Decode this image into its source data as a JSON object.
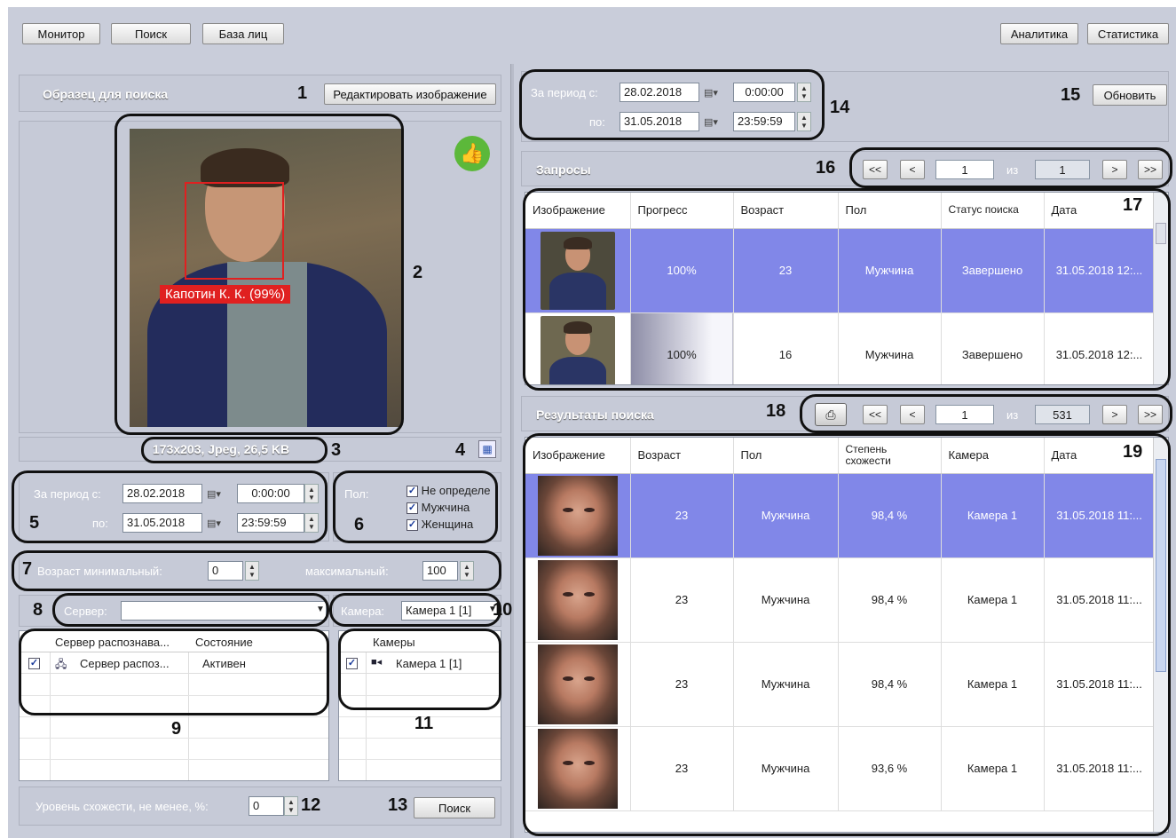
{
  "toolbar": {
    "monitor": "Монитор",
    "search": "Поиск",
    "facebase": "База лиц",
    "analytics": "Аналитика",
    "statistics": "Статистика"
  },
  "sample": {
    "title": "Образец для поиска",
    "edit_button": "Редактировать изображение",
    "face_label": "Капотин К. К. (99%)",
    "image_info": "173x203, Jpeg, 26,5 KB"
  },
  "filters": {
    "period_from_label": "За период с:",
    "period_to_label": "по:",
    "date_from": "28.02.2018",
    "time_from": "0:00:00",
    "date_to": "31.05.2018",
    "time_to": "23:59:59",
    "gender_label": "Пол:",
    "gender_options": [
      "Не определе",
      "Мужчина",
      "Женщина"
    ],
    "age_min_label": "Возраст минимальный:",
    "age_min": "0",
    "age_max_label": "максимальный:",
    "age_max": "100",
    "server_label": "Сервер:",
    "server_value": "",
    "camera_label": "Камера:",
    "camera_value": "Камера 1 [1]",
    "similarity_label": "Уровень схожести, не менее, %:",
    "similarity_value": "0",
    "search_button": "Поиск"
  },
  "servers_table": {
    "headers": [
      "Сервер распознава...",
      "Состояние"
    ],
    "rows": [
      {
        "name": "Сервер распоз...",
        "status": "Активен"
      }
    ]
  },
  "cameras_table": {
    "header": "Камеры",
    "rows": [
      {
        "name": "Камера 1 [1]"
      }
    ]
  },
  "right": {
    "period_from_label": "За период с:",
    "period_to_label": "по:",
    "date_from": "28.02.2018",
    "time_from": "0:00:00",
    "date_to": "31.05.2018",
    "time_to": "23:59:59",
    "refresh_button": "Обновить",
    "requests_title": "Запросы",
    "requests_pager": {
      "first": "<<",
      "prev": "<",
      "page": "1",
      "of": "из",
      "total": "1",
      "next": ">",
      "last": ">>"
    },
    "requests_headers": [
      "Изображение",
      "Прогресс",
      "Возраст",
      "Пол",
      "Статус поиска",
      "Дата"
    ],
    "requests": [
      {
        "progress": "100%",
        "progress_fraction": 1.0,
        "age": "23",
        "gender": "Мужчина",
        "status": "Завершено",
        "date": "31.05.2018 12:..."
      },
      {
        "progress": "100%",
        "progress_fraction": 1.0,
        "age": "16",
        "gender": "Мужчина",
        "status": "Завершено",
        "date": "31.05.2018 12:..."
      }
    ],
    "results_title": "Результаты поиска",
    "results_pager": {
      "first": "<<",
      "prev": "<",
      "page": "1",
      "of": "из",
      "total": "531",
      "next": ">",
      "last": ">>"
    },
    "results_headers": [
      "Изображение",
      "Возраст",
      "Пол",
      "Степень схожести",
      "Камера",
      "Дата"
    ],
    "results": [
      {
        "age": "23",
        "gender": "Мужчина",
        "similarity": "98,4 %",
        "camera": "Камера 1",
        "date": "31.05.2018 11:..."
      },
      {
        "age": "23",
        "gender": "Мужчина",
        "similarity": "98,4 %",
        "camera": "Камера 1",
        "date": "31.05.2018 11:..."
      },
      {
        "age": "23",
        "gender": "Мужчина",
        "similarity": "98,4 %",
        "camera": "Камера 1",
        "date": "31.05.2018 11:..."
      },
      {
        "age": "23",
        "gender": "Мужчина",
        "similarity": "93,6 %",
        "camera": "Камера 1",
        "date": "31.05.2018 11:..."
      }
    ]
  },
  "callouts": [
    "1",
    "2",
    "3",
    "4",
    "5",
    "6",
    "7",
    "8",
    "9",
    "10",
    "11",
    "12",
    "13",
    "14",
    "15",
    "16",
    "17",
    "18",
    "19"
  ],
  "colors": {
    "background": "#c9cdda",
    "selected_row": "#8187e8",
    "accent_green": "#5cb83a"
  }
}
